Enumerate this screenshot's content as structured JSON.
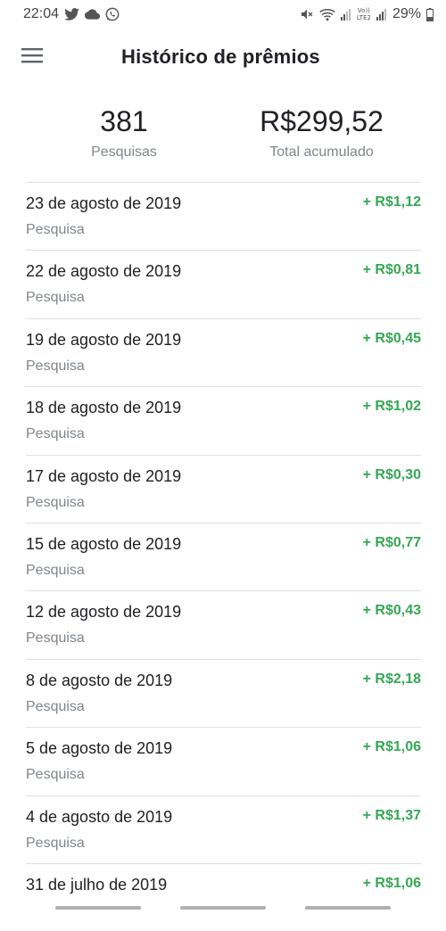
{
  "status_bar": {
    "time": "22:04",
    "battery": "29%",
    "left_icons": [
      "twitter-icon",
      "cloud-icon",
      "whatsapp-icon"
    ],
    "right_icons": [
      "mute-icon",
      "wifi-icon",
      "signal-icon",
      "volte-icon",
      "signal-icon-2",
      "battery-icon"
    ],
    "volte_label_1": "Vo))",
    "volte_label_2": "LTE2"
  },
  "app_bar": {
    "title": "Histórico de prêmios",
    "menu_icon": "menu-icon"
  },
  "summary": {
    "count_value": "381",
    "count_label": "Pesquisas",
    "total_value": "R$299,52",
    "total_label": "Total acumulado"
  },
  "history": [
    {
      "date": "23 de agosto de 2019",
      "type": "Pesquisa",
      "amount": "+ R$1,12"
    },
    {
      "date": "22 de agosto de 2019",
      "type": "Pesquisa",
      "amount": "+ R$0,81"
    },
    {
      "date": "19 de agosto de 2019",
      "type": "Pesquisa",
      "amount": "+ R$0,45"
    },
    {
      "date": "18 de agosto de 2019",
      "type": "Pesquisa",
      "amount": "+ R$1,02"
    },
    {
      "date": "17 de agosto de 2019",
      "type": "Pesquisa",
      "amount": "+ R$0,30"
    },
    {
      "date": "15 de agosto de 2019",
      "type": "Pesquisa",
      "amount": "+ R$0,77"
    },
    {
      "date": "12 de agosto de 2019",
      "type": "Pesquisa",
      "amount": "+ R$0,43"
    },
    {
      "date": "8 de agosto de 2019",
      "type": "Pesquisa",
      "amount": "+ R$2,18"
    },
    {
      "date": "5 de agosto de 2019",
      "type": "Pesquisa",
      "amount": "+ R$1,06"
    },
    {
      "date": "4 de agosto de 2019",
      "type": "Pesquisa",
      "amount": "+ R$1,37"
    },
    {
      "date": "31 de julho de 2019",
      "type": "",
      "amount": "+ R$1,06"
    }
  ],
  "colors": {
    "amount_positive": "#34a853",
    "secondary_text": "#80868b",
    "divider": "#e0e0e0"
  }
}
